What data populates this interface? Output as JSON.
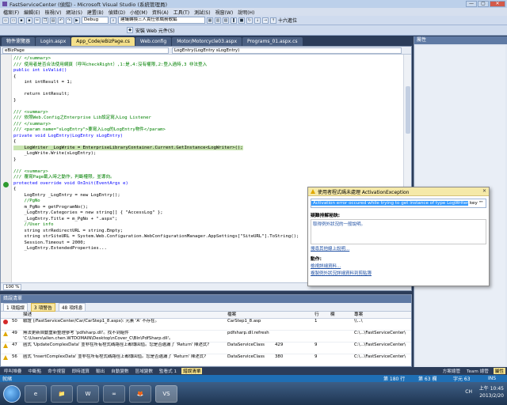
{
  "window": {
    "title": "FastServiceCenter (偵錯) - Microsoft Visual Studio (系統管理員)",
    "min": "—",
    "max": "▢",
    "close": "✕"
  },
  "menu": [
    "檔案(F)",
    "編輯(E)",
    "檢視(V)",
    "網站(S)",
    "建置(B)",
    "偵錯(D)",
    "小組(M)",
    "資料(A)",
    "工具(T)",
    "測試(S)",
    "視窗(W)",
    "說明(H)"
  ],
  "toolbar": {
    "config": "Debug",
    "find_combo": "建議轉換三人責任依職務歌編",
    "right_label": "十六進位",
    "web_element": "安裝 Web 元件(S)"
  },
  "doc_tabs": [
    "物件瀏覽器",
    "Login.aspx",
    "App_Code/eBizPage.cs",
    "Web.config",
    "Motor/Motorcycle03.aspx",
    "Programs_01.aspx.cs"
  ],
  "active_doc_tab_index": 2,
  "editor": {
    "nav_left": "eBizPage",
    "nav_right": "LogEntry(LogEntry sLogEntry)",
    "zoom": "100 %",
    "lines": [
      {
        "t": "/// </summary>",
        "c": "com"
      },
      {
        "t": "/// 使用者是否合法使用網頁（呼叫checkRight）,1:是,4:沒有權限,2:登入過時,3 非法登入",
        "c": "com"
      },
      {
        "t": "public int isValid()",
        "c": "kw"
      },
      {
        "t": "{",
        "c": ""
      },
      {
        "t": "    int intResult = 1;",
        "c": ""
      },
      {
        "t": "",
        "c": ""
      },
      {
        "t": "    return intResult;",
        "c": ""
      },
      {
        "t": "}",
        "c": ""
      },
      {
        "t": "",
        "c": ""
      },
      {
        "t": "/// <summary>",
        "c": "com"
      },
      {
        "t": "/// 依照Web.Config之Enterprise Lib設定寫入Log Listener",
        "c": "com"
      },
      {
        "t": "/// </summary>",
        "c": "com"
      },
      {
        "t": "/// <param name=\"sLogEntry\">要寫入Log的LogEntry物件</param>",
        "c": "com"
      },
      {
        "t": "private void LogEntry(LogEntry sLogEntry)",
        "c": "kw"
      },
      {
        "t": "{",
        "c": ""
      },
      {
        "t": "    LogWriter _LogWrite = EnterpriseLibraryContainer.Current.GetInstance<LogWriter>();",
        "c": "hl"
      },
      {
        "t": "    _LogWrite.Write(sLogEntry);",
        "c": ""
      },
      {
        "t": "}",
        "c": ""
      },
      {
        "t": "",
        "c": ""
      },
      {
        "t": "/// <summary>",
        "c": "com"
      },
      {
        "t": "/// 覆寫Page載入時之動作，判斷權限，並導向。",
        "c": "com"
      },
      {
        "t": "protected override void OnInit(EventArgs e)",
        "c": "kw"
      },
      {
        "t": "{",
        "c": ""
      },
      {
        "t": "    LogEntry _LogEntry = new LogEntry();",
        "c": ""
      },
      {
        "t": "    //PgNo",
        "c": "com"
      },
      {
        "t": "    m_PgNo = getProgramNo();",
        "c": ""
      },
      {
        "t": "    _LogEntry.Categories = new string[] { \"AccessLog\" };",
        "c": ""
      },
      {
        "t": "    _LogEntry.Title = m_PgNo + \".aspx\";",
        "c": ""
      },
      {
        "t": "    //User info",
        "c": "com"
      },
      {
        "t": "    string strRedirectURL = string.Empty;",
        "c": ""
      },
      {
        "t": "    string strSiteURL = System.Web.Configuration.WebConfigurationManager.AppSettings[\"SiteURL\"].ToString();",
        "c": ""
      },
      {
        "t": "    Session.Timeout = 2000;",
        "c": ""
      },
      {
        "t": "    _LogEntry.ExtendedProperties...",
        "c": ""
      }
    ]
  },
  "right_panel": {
    "title": "屬性"
  },
  "exception_popup": {
    "title": "使用者程式碼未處理 ActivationException",
    "close": "✕",
    "message": "Activation error occured while trying to get instance of type LogWriter",
    "message_tail": "key \"\"",
    "tips_title": "疑難排解秘訣:",
    "tip": "取得例外狀況的一般說明。",
    "search_link": "搜尋其他線上說明...",
    "actions_title": "動作:",
    "actions": [
      "檢視詳細資料...",
      "複製例外狀況詳細資料到剪貼簿"
    ]
  },
  "error_list": {
    "title": "錯誤清單",
    "filters": [
      "1 項錯誤",
      "3 項警告",
      "48 項訊息"
    ],
    "columns": [
      "",
      "",
      "描述",
      "檔案",
      "",
      "行",
      "欄",
      "專案"
    ],
    "rows": [
      {
        "type": "error",
        "num": "50",
        "desc": "驗證 (/FastServiceCenter/Car/CarStep1_8.aspx): 元素 'A' 不存在。",
        "file": "CarStep1_8.asp",
        "col5": "",
        "line": "1",
        "col": "",
        "project": "\\\\...\\"
      },
      {
        "type": "warn",
        "num": "49",
        "desc": "無法更新自動重新整理參考 'pdfsharp.dll'。找不到組件 'C:\\Users\\allen.chen.WTDOMAIN\\Desktop\\nCover_C\\BIn\\PdfSharp.dll'。",
        "file": "pdfsharp.dll.refresh",
        "col5": "",
        "line": "",
        "col": "",
        "project": "C:\\...\\FastServiceCenter\\"
      },
      {
        "type": "warn",
        "num": "47",
        "desc": "函式 'UpdateComplexData' 並非在所有程式碼路徑上都傳回值。您是否遺漏了 'Return' 陳述式?",
        "file": "DataServiceClass",
        "col5": "429",
        "line": "9",
        "col": "",
        "project": "C:\\...\\FastServiceCenter\\"
      },
      {
        "type": "warn",
        "num": "56",
        "desc": "函式 'InsertComplexData' 並非在所有程式碼路徑上都傳回值。您是否遺漏了 'Return' 陳述式?",
        "file": "DataServiceClass",
        "col5": "380",
        "line": "9",
        "col": "",
        "project": "C:\\...\\FastServiceCenter\\"
      }
    ]
  },
  "bottom_tabs": [
    "呼叫堆疊",
    "中斷點",
    "命令視窗",
    "即時運算",
    "輸出",
    "自動變數",
    "區域變數",
    "監看式 1",
    "錯誤清單"
  ],
  "bottom_right_tabs": [
    "方案總管",
    "Team 總管",
    "屬性"
  ],
  "status": {
    "ready": "就緒",
    "line": "第 180 行",
    "col": "第 63 欄",
    "ch": "字元 63",
    "mode": "INS"
  },
  "taskbar": {
    "apps": [
      "e",
      "📁",
      "W",
      "∞",
      "🦊",
      "VS"
    ],
    "lang": "CH",
    "time": "上午 10:45",
    "date": "2013/2/20"
  }
}
